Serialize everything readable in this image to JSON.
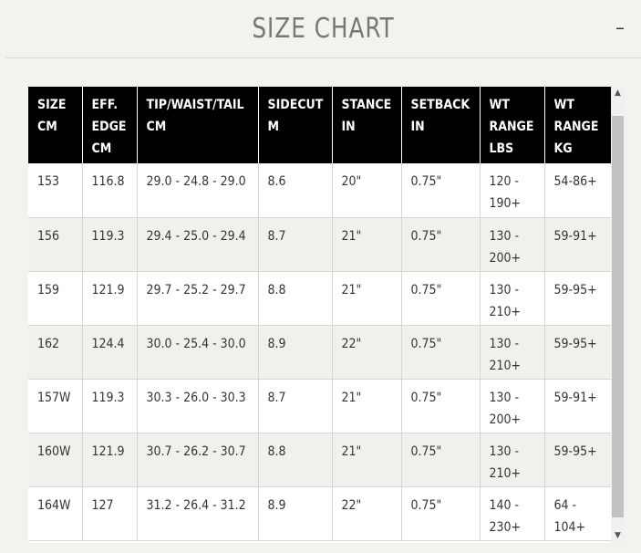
{
  "header": {
    "title": "SIZE CHART",
    "collapse_symbol": "–"
  },
  "table": {
    "columns": [
      [
        "SIZE",
        "CM"
      ],
      [
        "EFF.",
        "EDGE",
        "CM"
      ],
      [
        "TIP/WAIST/TAIL",
        "CM"
      ],
      [
        "SIDECUT",
        "M"
      ],
      [
        "STANCE",
        "IN"
      ],
      [
        "SETBACK",
        "IN"
      ],
      [
        "WT",
        "RANGE",
        "LBS"
      ],
      [
        "WT",
        "RANGE",
        "KG"
      ]
    ],
    "rows": [
      [
        "153",
        "116.8",
        "29.0 - 24.8 - 29.0",
        "8.6",
        "20\"",
        "0.75\"",
        "120 - 190+",
        "54-86+"
      ],
      [
        "156",
        "119.3",
        "29.4 - 25.0 - 29.4",
        "8.7",
        "21\"",
        "0.75\"",
        "130 - 200+",
        "59-91+"
      ],
      [
        "159",
        "121.9",
        "29.7 - 25.2 - 29.7",
        "8.8",
        "21\"",
        "0.75\"",
        "130 - 210+",
        "59-95+"
      ],
      [
        "162",
        "124.4",
        "30.0 - 25.4 - 30.0",
        "8.9",
        "22\"",
        "0.75\"",
        "130 - 210+",
        "59-95+"
      ],
      [
        "157W",
        "119.3",
        "30.3 - 26.0 - 30.3",
        "8.7",
        "21\"",
        "0.75\"",
        "130 - 200+",
        "59-91+"
      ],
      [
        "160W",
        "121.9",
        "30.7 - 26.2 - 30.7",
        "8.8",
        "21\"",
        "0.75\"",
        "130 - 210+",
        "59-95+"
      ],
      [
        "164W",
        "127",
        "31.2 - 26.4 - 31.2",
        "8.9",
        "22\"",
        "0.75\"",
        "140 - 230+",
        "64 - 104+"
      ]
    ]
  },
  "scrollbar": {
    "up_icon": "▲",
    "down_icon": "▼"
  },
  "colors": {
    "header_bg": "#000000",
    "row_alt": "#f1f1ec",
    "title": "#777777"
  }
}
